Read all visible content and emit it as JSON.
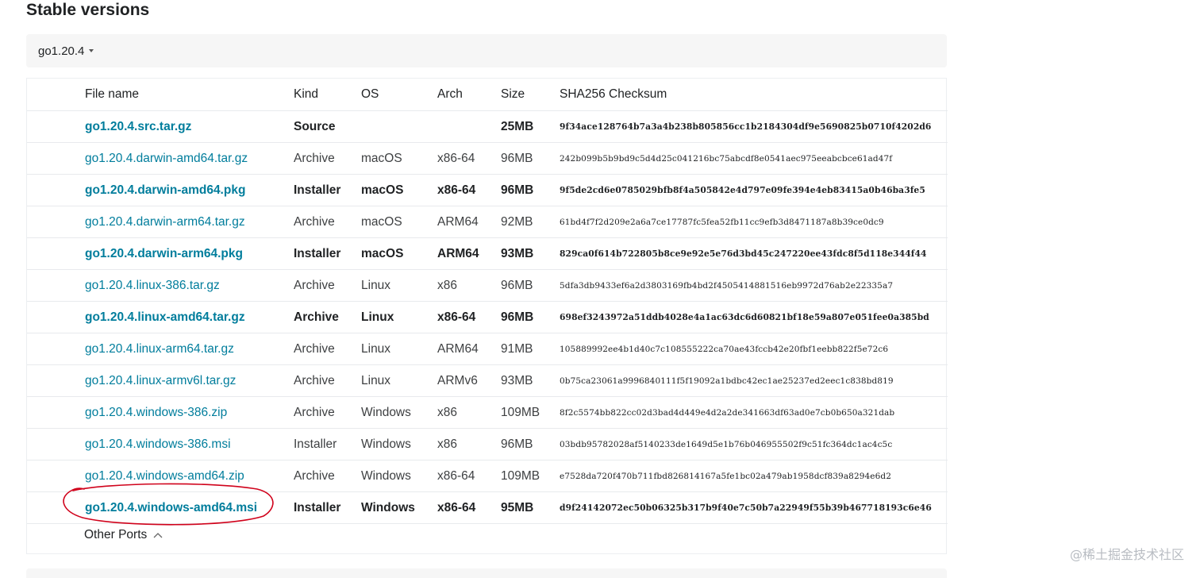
{
  "section_title": "Stable versions",
  "version_toggle": {
    "label": "go1.20.4"
  },
  "table": {
    "headers": [
      "File name",
      "Kind",
      "OS",
      "Arch",
      "Size",
      "SHA256 Checksum"
    ],
    "rows": [
      {
        "file": "go1.20.4.src.tar.gz",
        "kind": "Source",
        "os": "",
        "arch": "",
        "size": "25MB",
        "sha": "9f34ace128764b7a3a4b238b805856cc1b2184304df9e5690825b0710f4202d6",
        "highlight": true
      },
      {
        "file": "go1.20.4.darwin-amd64.tar.gz",
        "kind": "Archive",
        "os": "macOS",
        "arch": "x86-64",
        "size": "96MB",
        "sha": "242b099b5b9bd9c5d4d25c041216bc75abcdf8e0541aec975eeabcbce61ad47f",
        "highlight": false
      },
      {
        "file": "go1.20.4.darwin-amd64.pkg",
        "kind": "Installer",
        "os": "macOS",
        "arch": "x86-64",
        "size": "96MB",
        "sha": "9f5de2cd6e0785029bfb8f4a505842e4d797e09fe394e4eb83415a0b46ba3fe5",
        "highlight": true
      },
      {
        "file": "go1.20.4.darwin-arm64.tar.gz",
        "kind": "Archive",
        "os": "macOS",
        "arch": "ARM64",
        "size": "92MB",
        "sha": "61bd4f7f2d209e2a6a7ce17787fc5fea52fb11cc9efb3d8471187a8b39ce0dc9",
        "highlight": false
      },
      {
        "file": "go1.20.4.darwin-arm64.pkg",
        "kind": "Installer",
        "os": "macOS",
        "arch": "ARM64",
        "size": "93MB",
        "sha": "829ca0f614b722805b8ce9e92e5e76d3bd45c247220ee43fdc8f5d118e344f44",
        "highlight": true
      },
      {
        "file": "go1.20.4.linux-386.tar.gz",
        "kind": "Archive",
        "os": "Linux",
        "arch": "x86",
        "size": "96MB",
        "sha": "5dfa3db9433ef6a2d3803169fb4bd2f4505414881516eb9972d76ab2e22335a7",
        "highlight": false
      },
      {
        "file": "go1.20.4.linux-amd64.tar.gz",
        "kind": "Archive",
        "os": "Linux",
        "arch": "x86-64",
        "size": "96MB",
        "sha": "698ef3243972a51ddb4028e4a1ac63dc6d60821bf18e59a807e051fee0a385bd",
        "highlight": true
      },
      {
        "file": "go1.20.4.linux-arm64.tar.gz",
        "kind": "Archive",
        "os": "Linux",
        "arch": "ARM64",
        "size": "91MB",
        "sha": "105889992ee4b1d40c7c108555222ca70ae43fccb42e20fbf1eebb822f5e72c6",
        "highlight": false
      },
      {
        "file": "go1.20.4.linux-armv6l.tar.gz",
        "kind": "Archive",
        "os": "Linux",
        "arch": "ARMv6",
        "size": "93MB",
        "sha": "0b75ca23061a9996840111f5f19092a1bdbc42ec1ae25237ed2eec1c838bd819",
        "highlight": false
      },
      {
        "file": "go1.20.4.windows-386.zip",
        "kind": "Archive",
        "os": "Windows",
        "arch": "x86",
        "size": "109MB",
        "sha": "8f2c5574bb822cc02d3bad4d449e4d2a2de341663df63ad0e7cb0b650a321dab",
        "highlight": false
      },
      {
        "file": "go1.20.4.windows-386.msi",
        "kind": "Installer",
        "os": "Windows",
        "arch": "x86",
        "size": "96MB",
        "sha": "03bdb95782028af5140233de1649d5e1b76b046955502f9c51fc364dc1ac4c5c",
        "highlight": false
      },
      {
        "file": "go1.20.4.windows-amd64.zip",
        "kind": "Archive",
        "os": "Windows",
        "arch": "x86-64",
        "size": "109MB",
        "sha": "e7528da720f470b711fbd826814167a5fe1bc02a479ab1958dcf839a8294e6d2",
        "highlight": false
      },
      {
        "file": "go1.20.4.windows-amd64.msi",
        "kind": "Installer",
        "os": "Windows",
        "arch": "x86-64",
        "size": "95MB",
        "sha": "d9f24142072ec50b06325b317b9f40e7c50b7a22949f55b39b467718193c6e46",
        "highlight": true
      }
    ]
  },
  "other_ports": {
    "label": "Other Ports"
  },
  "watermark": "@稀土掘金技术社区",
  "colors": {
    "link": "#007d9c",
    "annotation": "#d0021b"
  }
}
